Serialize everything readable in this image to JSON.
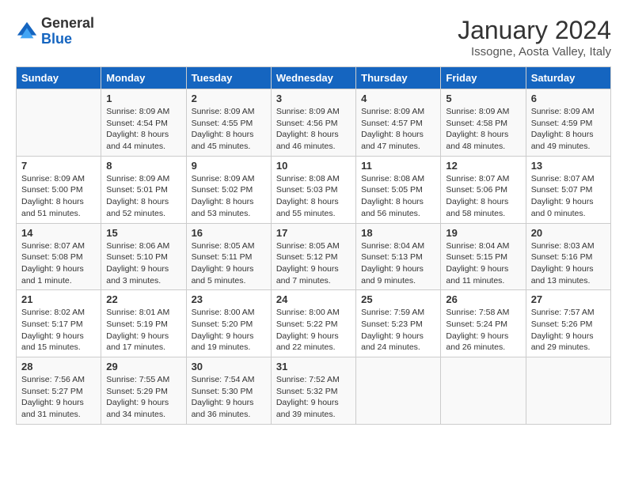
{
  "header": {
    "logo_general": "General",
    "logo_blue": "Blue",
    "month_title": "January 2024",
    "location": "Issogne, Aosta Valley, Italy"
  },
  "days_of_week": [
    "Sunday",
    "Monday",
    "Tuesday",
    "Wednesday",
    "Thursday",
    "Friday",
    "Saturday"
  ],
  "weeks": [
    [
      {
        "day": "",
        "sunrise": "",
        "sunset": "",
        "daylight": ""
      },
      {
        "day": "1",
        "sunrise": "Sunrise: 8:09 AM",
        "sunset": "Sunset: 4:54 PM",
        "daylight": "Daylight: 8 hours and 44 minutes."
      },
      {
        "day": "2",
        "sunrise": "Sunrise: 8:09 AM",
        "sunset": "Sunset: 4:55 PM",
        "daylight": "Daylight: 8 hours and 45 minutes."
      },
      {
        "day": "3",
        "sunrise": "Sunrise: 8:09 AM",
        "sunset": "Sunset: 4:56 PM",
        "daylight": "Daylight: 8 hours and 46 minutes."
      },
      {
        "day": "4",
        "sunrise": "Sunrise: 8:09 AM",
        "sunset": "Sunset: 4:57 PM",
        "daylight": "Daylight: 8 hours and 47 minutes."
      },
      {
        "day": "5",
        "sunrise": "Sunrise: 8:09 AM",
        "sunset": "Sunset: 4:58 PM",
        "daylight": "Daylight: 8 hours and 48 minutes."
      },
      {
        "day": "6",
        "sunrise": "Sunrise: 8:09 AM",
        "sunset": "Sunset: 4:59 PM",
        "daylight": "Daylight: 8 hours and 49 minutes."
      }
    ],
    [
      {
        "day": "7",
        "sunrise": "Sunrise: 8:09 AM",
        "sunset": "Sunset: 5:00 PM",
        "daylight": "Daylight: 8 hours and 51 minutes."
      },
      {
        "day": "8",
        "sunrise": "Sunrise: 8:09 AM",
        "sunset": "Sunset: 5:01 PM",
        "daylight": "Daylight: 8 hours and 52 minutes."
      },
      {
        "day": "9",
        "sunrise": "Sunrise: 8:09 AM",
        "sunset": "Sunset: 5:02 PM",
        "daylight": "Daylight: 8 hours and 53 minutes."
      },
      {
        "day": "10",
        "sunrise": "Sunrise: 8:08 AM",
        "sunset": "Sunset: 5:03 PM",
        "daylight": "Daylight: 8 hours and 55 minutes."
      },
      {
        "day": "11",
        "sunrise": "Sunrise: 8:08 AM",
        "sunset": "Sunset: 5:05 PM",
        "daylight": "Daylight: 8 hours and 56 minutes."
      },
      {
        "day": "12",
        "sunrise": "Sunrise: 8:07 AM",
        "sunset": "Sunset: 5:06 PM",
        "daylight": "Daylight: 8 hours and 58 minutes."
      },
      {
        "day": "13",
        "sunrise": "Sunrise: 8:07 AM",
        "sunset": "Sunset: 5:07 PM",
        "daylight": "Daylight: 9 hours and 0 minutes."
      }
    ],
    [
      {
        "day": "14",
        "sunrise": "Sunrise: 8:07 AM",
        "sunset": "Sunset: 5:08 PM",
        "daylight": "Daylight: 9 hours and 1 minute."
      },
      {
        "day": "15",
        "sunrise": "Sunrise: 8:06 AM",
        "sunset": "Sunset: 5:10 PM",
        "daylight": "Daylight: 9 hours and 3 minutes."
      },
      {
        "day": "16",
        "sunrise": "Sunrise: 8:05 AM",
        "sunset": "Sunset: 5:11 PM",
        "daylight": "Daylight: 9 hours and 5 minutes."
      },
      {
        "day": "17",
        "sunrise": "Sunrise: 8:05 AM",
        "sunset": "Sunset: 5:12 PM",
        "daylight": "Daylight: 9 hours and 7 minutes."
      },
      {
        "day": "18",
        "sunrise": "Sunrise: 8:04 AM",
        "sunset": "Sunset: 5:13 PM",
        "daylight": "Daylight: 9 hours and 9 minutes."
      },
      {
        "day": "19",
        "sunrise": "Sunrise: 8:04 AM",
        "sunset": "Sunset: 5:15 PM",
        "daylight": "Daylight: 9 hours and 11 minutes."
      },
      {
        "day": "20",
        "sunrise": "Sunrise: 8:03 AM",
        "sunset": "Sunset: 5:16 PM",
        "daylight": "Daylight: 9 hours and 13 minutes."
      }
    ],
    [
      {
        "day": "21",
        "sunrise": "Sunrise: 8:02 AM",
        "sunset": "Sunset: 5:17 PM",
        "daylight": "Daylight: 9 hours and 15 minutes."
      },
      {
        "day": "22",
        "sunrise": "Sunrise: 8:01 AM",
        "sunset": "Sunset: 5:19 PM",
        "daylight": "Daylight: 9 hours and 17 minutes."
      },
      {
        "day": "23",
        "sunrise": "Sunrise: 8:00 AM",
        "sunset": "Sunset: 5:20 PM",
        "daylight": "Daylight: 9 hours and 19 minutes."
      },
      {
        "day": "24",
        "sunrise": "Sunrise: 8:00 AM",
        "sunset": "Sunset: 5:22 PM",
        "daylight": "Daylight: 9 hours and 22 minutes."
      },
      {
        "day": "25",
        "sunrise": "Sunrise: 7:59 AM",
        "sunset": "Sunset: 5:23 PM",
        "daylight": "Daylight: 9 hours and 24 minutes."
      },
      {
        "day": "26",
        "sunrise": "Sunrise: 7:58 AM",
        "sunset": "Sunset: 5:24 PM",
        "daylight": "Daylight: 9 hours and 26 minutes."
      },
      {
        "day": "27",
        "sunrise": "Sunrise: 7:57 AM",
        "sunset": "Sunset: 5:26 PM",
        "daylight": "Daylight: 9 hours and 29 minutes."
      }
    ],
    [
      {
        "day": "28",
        "sunrise": "Sunrise: 7:56 AM",
        "sunset": "Sunset: 5:27 PM",
        "daylight": "Daylight: 9 hours and 31 minutes."
      },
      {
        "day": "29",
        "sunrise": "Sunrise: 7:55 AM",
        "sunset": "Sunset: 5:29 PM",
        "daylight": "Daylight: 9 hours and 34 minutes."
      },
      {
        "day": "30",
        "sunrise": "Sunrise: 7:54 AM",
        "sunset": "Sunset: 5:30 PM",
        "daylight": "Daylight: 9 hours and 36 minutes."
      },
      {
        "day": "31",
        "sunrise": "Sunrise: 7:52 AM",
        "sunset": "Sunset: 5:32 PM",
        "daylight": "Daylight: 9 hours and 39 minutes."
      },
      {
        "day": "",
        "sunrise": "",
        "sunset": "",
        "daylight": ""
      },
      {
        "day": "",
        "sunrise": "",
        "sunset": "",
        "daylight": ""
      },
      {
        "day": "",
        "sunrise": "",
        "sunset": "",
        "daylight": ""
      }
    ]
  ]
}
